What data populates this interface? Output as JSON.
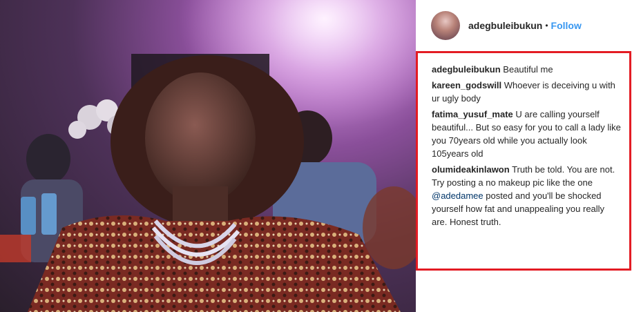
{
  "post": {
    "username": "adegbuleibukun",
    "separator": "•",
    "follow_label": "Follow"
  },
  "comments": [
    {
      "user": "adegbuleibukun",
      "text": "Beautiful me"
    },
    {
      "user": "kareen_godswill",
      "text": "Whoever is deceiving u with ur ugly body"
    },
    {
      "user": "fatima_yusuf_mate",
      "text": "U are calling yourself beautiful... But so easy for you to call a lady like you 70years old while you actually look 105years old"
    },
    {
      "user": "olumideakinlawon",
      "text_before": "Truth be told. You are not. Try posting a no makeup pic like the one",
      "mention": "@adedamee",
      "text_after": "posted and you'll be shocked yourself how fat and unappealing you really are. Honest truth."
    }
  ],
  "colors": {
    "follow": "#3897f0",
    "highlight_border": "#e31b23",
    "mention": "#003569"
  },
  "icons": {
    "avatar": "profile-avatar"
  }
}
